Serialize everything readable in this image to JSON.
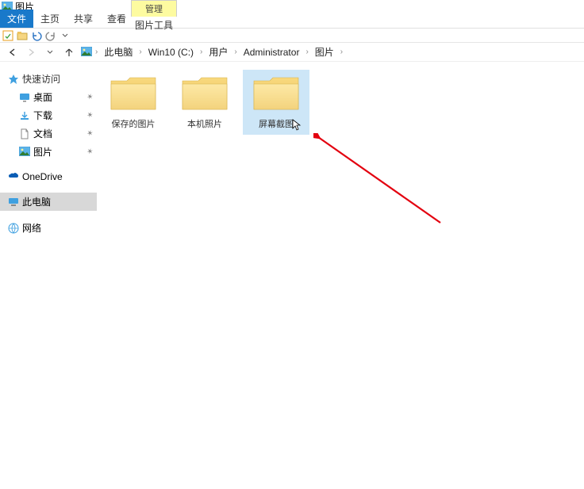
{
  "title": "图片",
  "ribbon": {
    "file": "文件",
    "home": "主页",
    "share": "共享",
    "view": "查看",
    "manage_top": "管理",
    "pic_tools": "图片工具"
  },
  "breadcrumb": {
    "items": [
      "此电脑",
      "Win10 (C:)",
      "用户",
      "Administrator",
      "图片"
    ]
  },
  "sidebar": {
    "quick": "快速访问",
    "quick_items": [
      {
        "label": "桌面"
      },
      {
        "label": "下载"
      },
      {
        "label": "文档"
      },
      {
        "label": "图片"
      }
    ],
    "onedrive": "OneDrive",
    "this_pc": "此电脑",
    "network": "网络"
  },
  "folders": {
    "items": [
      {
        "name": "保存的图片",
        "selected": false
      },
      {
        "name": "本机照片",
        "selected": false
      },
      {
        "name": "屏幕截图",
        "selected": true
      }
    ]
  }
}
